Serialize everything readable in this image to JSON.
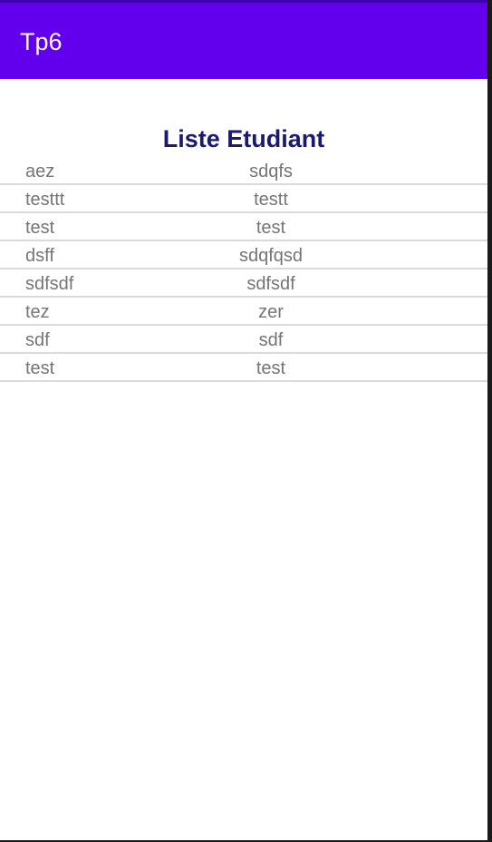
{
  "app_bar": {
    "title": "Tp6",
    "color": "#6200ee"
  },
  "list": {
    "title": "Liste Etudiant",
    "title_color": "#1a1a72",
    "rows": [
      {
        "col1": "aez",
        "col2": "sdqfs"
      },
      {
        "col1": "testtt",
        "col2": "testt"
      },
      {
        "col1": "test",
        "col2": "test"
      },
      {
        "col1": "dsff",
        "col2": "sdqfqsd"
      },
      {
        "col1": "sdfsdf",
        "col2": "sdfsdf"
      },
      {
        "col1": "tez",
        "col2": "zer"
      },
      {
        "col1": "sdf",
        "col2": "sdf"
      },
      {
        "col1": "test",
        "col2": "test"
      }
    ]
  }
}
